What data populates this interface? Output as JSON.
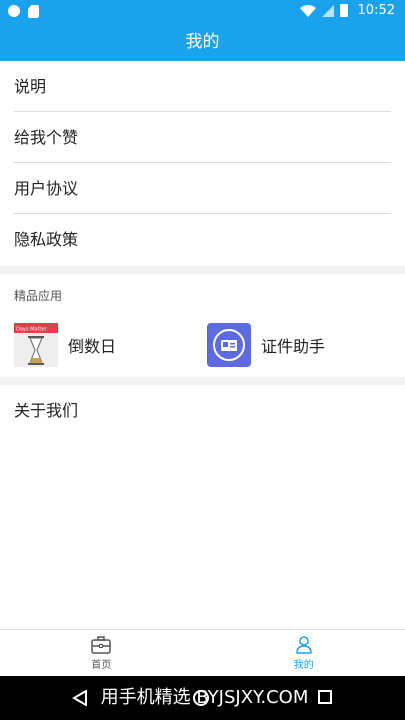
{
  "status_bar": {
    "time": "10:52"
  },
  "header": {
    "title": "我的"
  },
  "menu": [
    {
      "label": "说明"
    },
    {
      "label": "给我个赞"
    },
    {
      "label": "用户协议"
    },
    {
      "label": "隐私政策"
    }
  ],
  "featured": {
    "heading": "精品应用",
    "apps": [
      {
        "label": "倒数日",
        "icon": "hourglass-icon",
        "icon_text": "Days Matter"
      },
      {
        "label": "证件助手",
        "icon": "id-card-icon"
      }
    ]
  },
  "about": {
    "label": "关于我们"
  },
  "tabs": [
    {
      "label": "首页",
      "icon": "home-toolbox-icon",
      "active": false
    },
    {
      "label": "我的",
      "icon": "person-icon",
      "active": true
    }
  ],
  "watermark": {
    "text": "用手机精选 BYJSJXY.COM"
  },
  "colors": {
    "accent": "#1aa3ec",
    "divider": "#dcdcdc",
    "section_gap": "#f2f2f2"
  }
}
